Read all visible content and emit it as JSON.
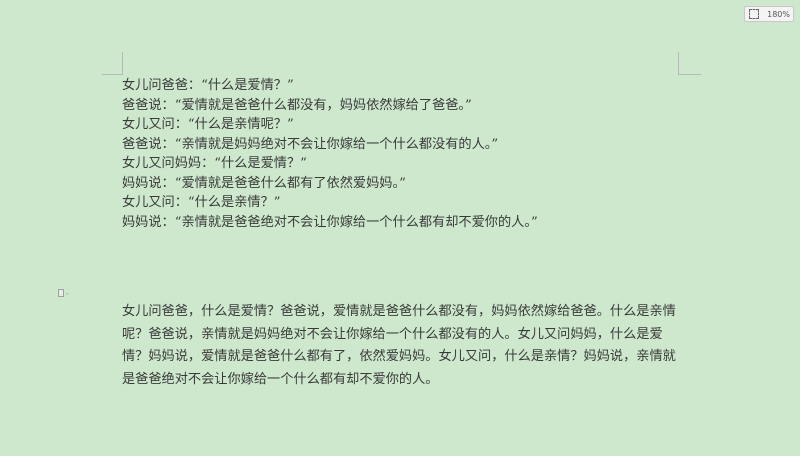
{
  "zoom": {
    "level_label": "180%"
  },
  "dialogue_lines": [
    "女儿问爸爸：“什么是爱情？”",
    "爸爸说：“爱情就是爸爸什么都没有，妈妈依然嫁给了爸爸。”",
    "女儿又问：“什么是亲情呢？”",
    "爸爸说：“亲情就是妈妈绝对不会让你嫁给一个什么都没有的人。”",
    "女儿又问妈妈：“什么是爱情？”",
    "妈妈说：“爱情就是爸爸什么都有了依然爱妈妈。”",
    "女儿又问：“什么是亲情？”",
    "妈妈说：“亲情就是爸爸绝对不会让你嫁给一个什么都有却不爱你的人。”"
  ],
  "paragraph_text": "女儿问爸爸，什么是爱情？爸爸说，爱情就是爸爸什么都没有，妈妈依然嫁给爸爸。什么是亲情呢？爸爸说，亲情就是妈妈绝对不会让你嫁给一个什么都没有的人。女儿又问妈妈，什么是爱情？妈妈说，爱情就是爸爸什么都有了，依然爱妈妈。女儿又问，什么是亲情？妈妈说，亲情就是爸爸绝对不会让你嫁给一个什么都有却不爱你的人。",
  "icons": {
    "fit_page": "fit-page-icon",
    "paragraph_marker": "document-icon"
  }
}
